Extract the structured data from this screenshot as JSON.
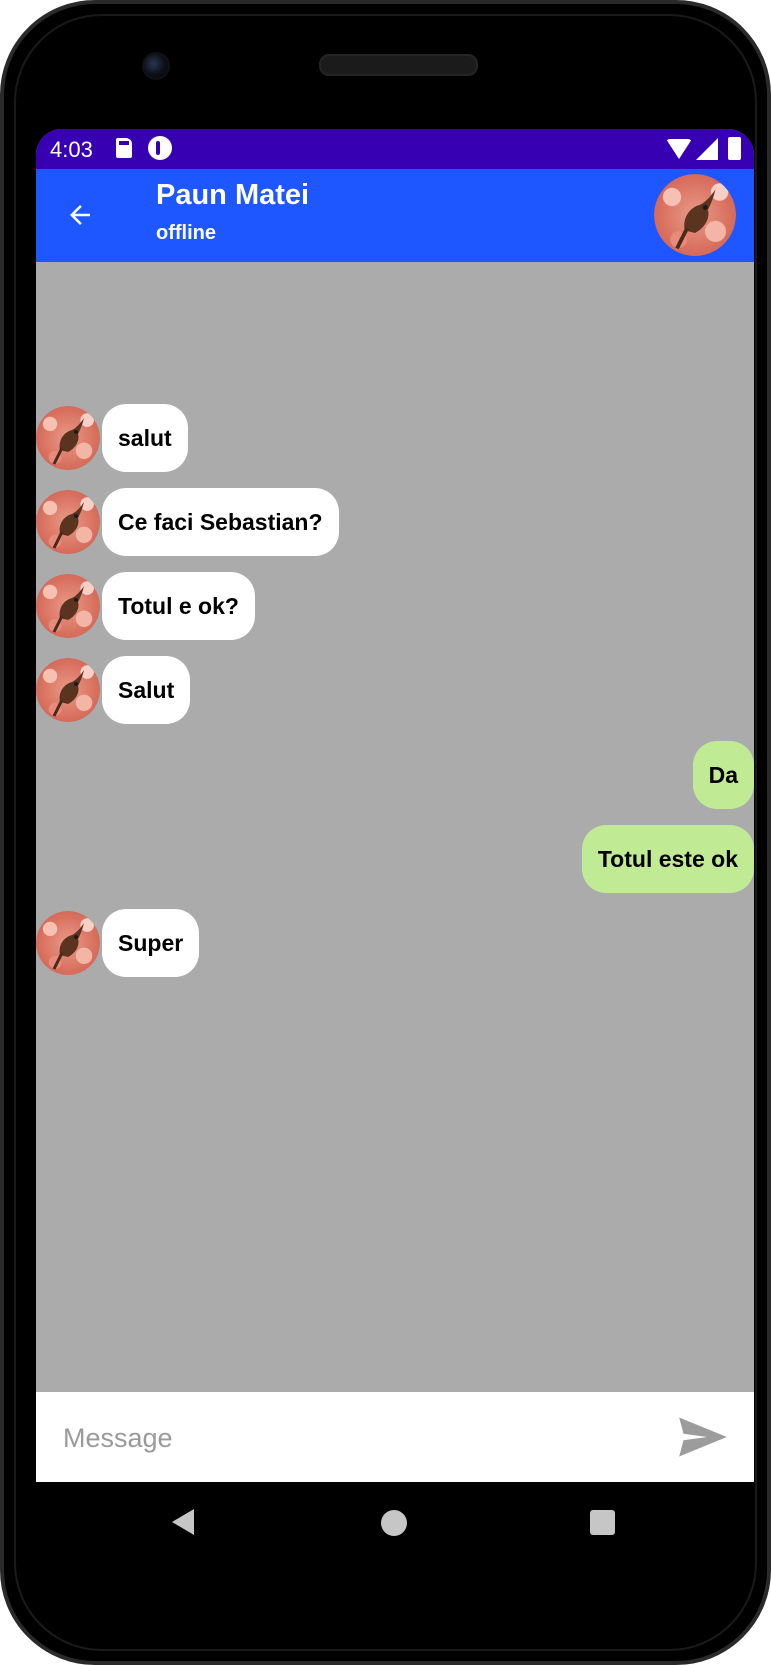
{
  "status_bar": {
    "time": "4:03",
    "icons": [
      "sd-card-icon",
      "app-notification-icon",
      "wifi-icon",
      "signal-icon",
      "battery-icon"
    ],
    "color": "#3700b3"
  },
  "header": {
    "contact_name": "Paun Matei",
    "contact_status": "offline",
    "color": "#1e56ff"
  },
  "messages": [
    {
      "direction": "incoming",
      "text": "salut"
    },
    {
      "direction": "incoming",
      "text": "Ce faci Sebastian?"
    },
    {
      "direction": "incoming",
      "text": "Totul e ok?"
    },
    {
      "direction": "incoming",
      "text": "Salut"
    },
    {
      "direction": "outgoing",
      "text": "Da"
    },
    {
      "direction": "outgoing",
      "text": "Totul este ok"
    },
    {
      "direction": "incoming",
      "text": "Super"
    }
  ],
  "composer": {
    "placeholder": "Message",
    "value": ""
  },
  "colors": {
    "chat_background": "#ababab",
    "incoming_bubble": "#ffffff",
    "outgoing_bubble": "#c0ea94"
  }
}
